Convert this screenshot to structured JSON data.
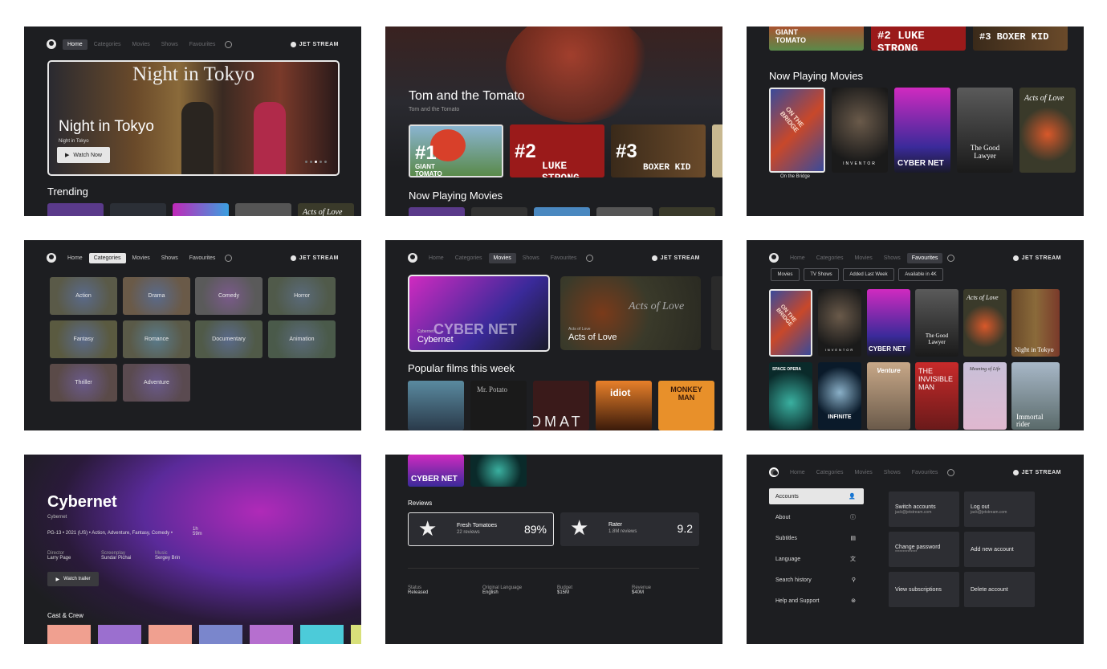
{
  "nav": {
    "home": "Home",
    "categories": "Categories",
    "movies": "Movies",
    "shows": "Shows",
    "favourites": "Favourites",
    "brand": "JET STREAM"
  },
  "p1": {
    "hero_poster_title": "Night in Tokyo",
    "hero_title": "Night in Tokyo",
    "hero_sub": "Night in Tokyo",
    "watch_now": "Watch Now",
    "trending": "Trending",
    "acts_of_love_tile": "Acts of Love"
  },
  "p2": {
    "hero_title": "Tom and the Tomato",
    "hero_sub": "Tom and the Tomato",
    "tiles": [
      {
        "rank": "#1",
        "art": "GIANT TOMATO"
      },
      {
        "rank": "#2",
        "art": "LUKE STRONG"
      },
      {
        "rank": "#3",
        "art": "BOXER KID"
      }
    ],
    "now_playing": "Now Playing Movies"
  },
  "p3": {
    "top_tiles": [
      "GIANT TOMATO",
      "#2 LUKE STRONG",
      "#3 BOXER KID"
    ],
    "now_playing": "Now Playing Movies",
    "posters": [
      "ON THE BRIDGE",
      "INVENTOR",
      "CYBER NET",
      "The Good Lawyer",
      "Acts of Love"
    ],
    "selected_caption": "On the Bridge"
  },
  "p4": {
    "categories": [
      "Action",
      "Drama",
      "Comedy",
      "Horror",
      "Fantasy",
      "Romance",
      "Documentary",
      "Animation",
      "Thriller",
      "Adventure"
    ]
  },
  "p5": {
    "feature1_small": "Cybernet",
    "feature1_title": "Cybernet",
    "feature1_art": "CYBER NET",
    "feature2_small": "Acts of Love",
    "feature2_title": "Acts of Love",
    "feature2_art": "Acts of Love",
    "popular": "Popular films this week",
    "posters": [
      "",
      "Mr. Potato",
      "OMAT",
      "idiot",
      "MONKEY MAN"
    ]
  },
  "p6": {
    "chips": [
      "Movies",
      "TV Shows",
      "Added Last Week",
      "Available in 4K"
    ],
    "posters": [
      "ON THE BRIDGE",
      "INVENTOR",
      "CYBER NET",
      "The Good Lawyer",
      "Acts of Love",
      "Night in Tokyo",
      "SPACE OPERA",
      "INFINITE",
      "Venture",
      "THE INVISIBLE MAN",
      "Meaning of Life",
      "Immortal rider"
    ]
  },
  "p7": {
    "title": "Cybernet",
    "subtitle": "Cybernet",
    "meta": "PG-13  •  2021 (US)  •  Action, Adventure, Fantasy, Comedy  •",
    "duration": "1h 59m",
    "credits": [
      {
        "role": "Director",
        "name": "Larry Page"
      },
      {
        "role": "Screenplay",
        "name": "Sundar Pichai"
      },
      {
        "role": "Music",
        "name": "Sergey Brin"
      }
    ],
    "watch_trailer": "Watch trailer",
    "cast_crew": "Cast & Crew",
    "cast_colors": [
      "#f0a090",
      "#9b6fcf",
      "#f0a090",
      "#7a86cc",
      "#b66fcf",
      "#4ccbd9",
      "#d8e07a"
    ]
  },
  "p8": {
    "top_art": "CYBER NET",
    "reviews": "Reviews",
    "review_cards": [
      {
        "name": "Fresh Tomatoes",
        "count": "22 reviews",
        "score": "89%"
      },
      {
        "name": "Rater",
        "count": "1.8M reviews",
        "score": "9.2"
      }
    ],
    "facts": [
      {
        "label": "Status",
        "value": "Released"
      },
      {
        "label": "Original Language",
        "value": "English"
      },
      {
        "label": "Budget",
        "value": "$15M"
      },
      {
        "label": "Revenue",
        "value": "$40M"
      }
    ]
  },
  "p9": {
    "menu": [
      {
        "label": "Accounts",
        "icon": "user-icon"
      },
      {
        "label": "About",
        "icon": "info-icon"
      },
      {
        "label": "Subtitles",
        "icon": "subtitles-icon"
      },
      {
        "label": "Language",
        "icon": "translate-icon"
      },
      {
        "label": "Search history",
        "icon": "search-icon"
      },
      {
        "label": "Help and Support",
        "icon": "support-icon"
      }
    ],
    "cards": [
      {
        "title": "Switch accounts",
        "sub": "jack@jetstream.com"
      },
      {
        "title": "Log out",
        "sub": "jack@jetstream.com"
      },
      {
        "title": "Change password",
        "sub": "**************"
      },
      {
        "title": "Add new account",
        "sub": ""
      },
      {
        "title": "View subscriptions",
        "sub": ""
      },
      {
        "title": "Delete account",
        "sub": ""
      }
    ]
  }
}
